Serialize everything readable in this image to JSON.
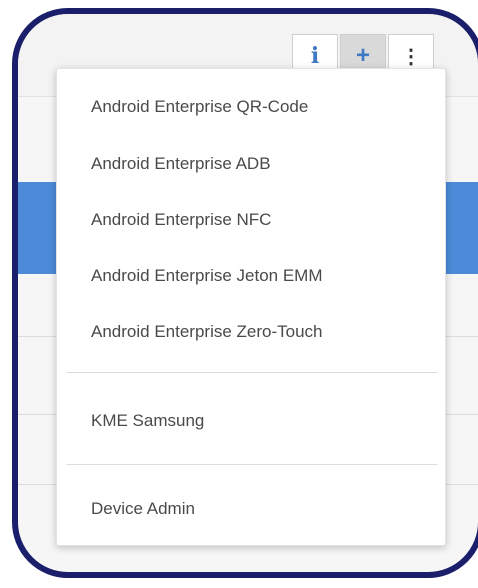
{
  "toolbar": {
    "info_icon": "i",
    "add_icon": "+",
    "more_icon": "⋮"
  },
  "menu": {
    "items": [
      {
        "label": "Android Enterprise QR-Code"
      },
      {
        "label": "Android Enterprise ADB"
      },
      {
        "label": "Android Enterprise NFC"
      },
      {
        "label": "Android Enterprise Jeton EMM"
      },
      {
        "label": "Android Enterprise Zero-Touch"
      }
    ],
    "kme_label": "KME Samsung",
    "device_admin_label": "Device Admin"
  },
  "colors": {
    "frame": "#1b1f6b",
    "accent": "#3f79c1",
    "selected_row": "#4b8bd8"
  }
}
